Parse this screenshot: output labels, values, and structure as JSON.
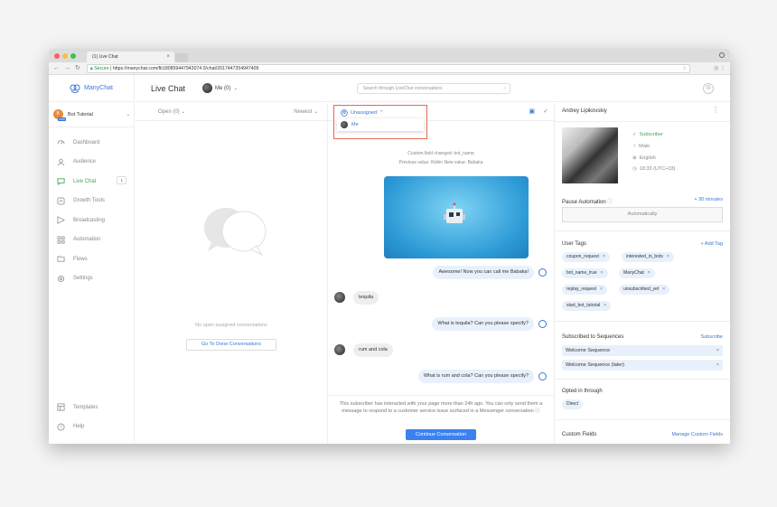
{
  "browser": {
    "tab_title": "(1) Live Chat",
    "tab_close": "×",
    "secure_label": "Secure",
    "url": "https://manychat.com/fb180859447943074 0/chat/2017447354947409"
  },
  "sidebar": {
    "brand": "ManyChat",
    "account": {
      "name": "Bot Tutorial",
      "avatar_letter": "B",
      "badge": "PRO"
    },
    "items": [
      {
        "label": "Dashboard",
        "icon": "dashboard-icon"
      },
      {
        "label": "Audience",
        "icon": "audience-icon"
      },
      {
        "label": "Live Chat",
        "icon": "chat-icon",
        "badge": "1",
        "active": true
      },
      {
        "label": "Growth Tools",
        "icon": "growth-icon"
      },
      {
        "label": "Broadcasting",
        "icon": "broadcast-icon"
      },
      {
        "label": "Automation",
        "icon": "automation-icon"
      },
      {
        "label": "Flows",
        "icon": "folder-icon"
      },
      {
        "label": "Settings",
        "icon": "gear-icon"
      }
    ],
    "bottom": [
      {
        "label": "Templates",
        "icon": "templates-icon"
      },
      {
        "label": "Help",
        "icon": "help-icon"
      }
    ]
  },
  "header": {
    "title": "Live Chat",
    "me_label": "Me (0)",
    "search_placeholder": "Search through LiveChat conversations"
  },
  "list": {
    "filter_open": "Open (0)",
    "sort": "Newest",
    "empty_text": "No open assigned conversations",
    "goto_done": "Go To Done Conversations"
  },
  "chat": {
    "assign_label": "Unassigned",
    "assign_option": "Me",
    "system_line1": "Custom field changed: bot_name",
    "system_line2": "Previous value: Robin   New value: Babaka",
    "messages": [
      {
        "side": "right",
        "text": "Awesome! Now you can call me Babaka!"
      },
      {
        "side": "left",
        "text": "tequila"
      },
      {
        "side": "right",
        "text": "What is tequila? Can you please specify?"
      },
      {
        "side": "left",
        "text": "rum and cola"
      },
      {
        "side": "right",
        "text": "What is rum and cola? Can you please specify?"
      }
    ],
    "notice": "This subscriber has interacted with your page more than 24h ago. You can only send them a message to respond to a customer service issue surfaced in a Messenger conversation ⓘ",
    "continue_button": "Continue Conversation"
  },
  "profile": {
    "name": "Andrey Lipikovskiy",
    "status": "Subscriber",
    "gender": "Male",
    "language": "English",
    "time": "18:33 (UTC+03)",
    "pause_title": "Pause Automation",
    "pause_link": "+ 30 minutes",
    "pause_value": "Automatically",
    "tags_title": "User Tags",
    "tags_link": "+ Add Tag",
    "tags": [
      "coupon_request",
      "interested_in_bots",
      "bot_name_true",
      "ManyChat",
      "replay_request",
      "unsubscribed_yet",
      "start_bot_tutorial"
    ],
    "seq_title": "Subscribed to Sequences",
    "seq_link": "Subscribe",
    "sequences": [
      "Welcome Sequence",
      "Welcome Sequence (later)"
    ],
    "optin_title": "Opted in through",
    "optin_value": "Direct",
    "custom_title": "Custom Fields",
    "custom_link": "Manage Custom Fields"
  },
  "colors": {
    "accent": "#3c77d6",
    "active": "#4aa25a",
    "highlight_border": "#e06b52"
  }
}
